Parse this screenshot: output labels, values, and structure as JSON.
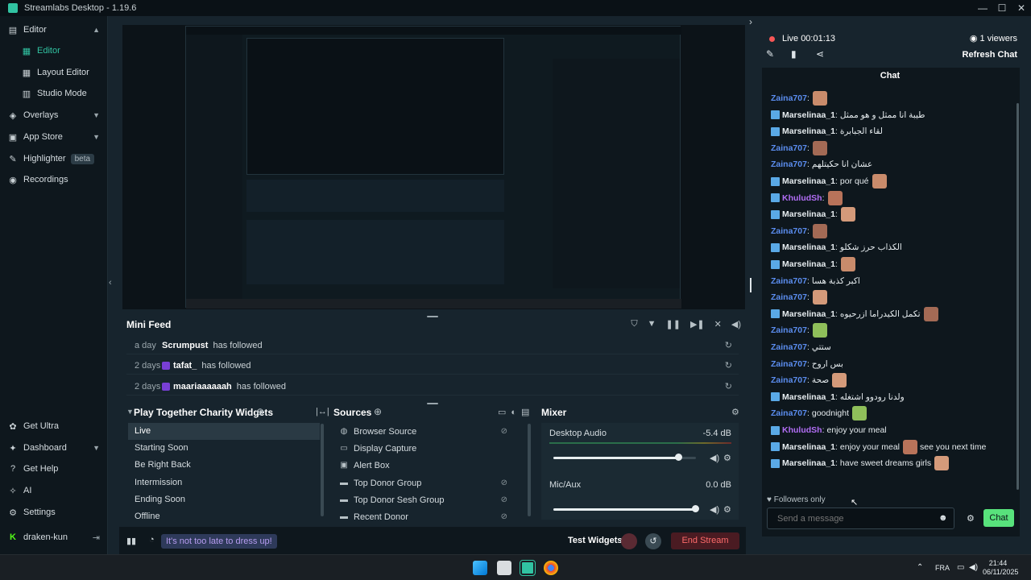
{
  "app": {
    "title": "Streamlabs Desktop - 1.19.6"
  },
  "window_controls": {
    "minimize": "—",
    "maximize": "☐",
    "close": "✕"
  },
  "sidebar": {
    "editor": "Editor",
    "editor_sub": "Editor",
    "layout_editor": "Layout Editor",
    "studio_mode": "Studio Mode",
    "overlays": "Overlays",
    "app_store": "App Store",
    "highlighter": "Highlighter",
    "highlighter_badge": "beta",
    "recordings": "Recordings",
    "get_ultra": "Get Ultra",
    "dashboard": "Dashboard",
    "get_help": "Get Help",
    "ai": "AI",
    "settings": "Settings",
    "user": "draken-kun"
  },
  "minifeed": {
    "title": "Mini Feed",
    "rows": [
      {
        "ago": "a day",
        "name": "Scrumpust",
        "action": "has followed"
      },
      {
        "ago": "2 days",
        "name": "tafat_",
        "action": "has followed"
      },
      {
        "ago": "2 days",
        "name": "maariaaaaaah",
        "action": "has followed"
      }
    ]
  },
  "scenes": {
    "title": "Play Together Charity Widgets",
    "items": [
      "Live",
      "Starting Soon",
      "Be Right Back",
      "Intermission",
      "Ending Soon",
      "Offline"
    ],
    "selected": "Live"
  },
  "sources": {
    "title": "Sources",
    "items": [
      {
        "label": "Browser Source",
        "icon": "globe-icon"
      },
      {
        "label": "Display Capture",
        "icon": "monitor-icon"
      },
      {
        "label": "Alert Box",
        "icon": "image-icon"
      },
      {
        "label": "Top Donor Group",
        "icon": "folder-icon"
      },
      {
        "label": "Top Donor Sesh Group",
        "icon": "folder-icon"
      },
      {
        "label": "Recent Donor",
        "icon": "folder-icon"
      }
    ]
  },
  "mixer": {
    "title": "Mixer",
    "channels": [
      {
        "name": "Desktop Audio",
        "value": "-5.4 dB",
        "level": 0.88
      },
      {
        "name": "Mic/Aux",
        "value": "0.0 dB",
        "level": 1.0
      }
    ]
  },
  "footer": {
    "notice": "It's not too late to dress up!",
    "test_widgets": "Test Widgets",
    "end_stream": "End Stream"
  },
  "stream": {
    "live_label": "Live",
    "live_time": "00:01:13",
    "viewers": "1 viewers",
    "refresh_chat": "Refresh Chat"
  },
  "chat": {
    "header": "Chat",
    "messages": [
      {
        "user": "Zaina707",
        "text": "",
        "emote": true,
        "badge": false,
        "color": "#5b8def"
      },
      {
        "user": "Marselinaa_1",
        "text": "طيبة انا ممثل و هو ممثل",
        "emote": false,
        "badge": true,
        "color": "#e6ecef"
      },
      {
        "user": "Marselinaa_1",
        "text": "لقاء الجبابرة",
        "emote": false,
        "badge": true,
        "color": "#e6ecef"
      },
      {
        "user": "Zaina707",
        "text": "",
        "emote": true,
        "badge": false,
        "color": "#5b8def"
      },
      {
        "user": "Zaina707",
        "text": "عشان انا حكيتلهم",
        "emote": false,
        "badge": false,
        "color": "#5b8def"
      },
      {
        "user": "Marselinaa_1",
        "text": "por qué",
        "emote": true,
        "badge": true,
        "color": "#e6ecef"
      },
      {
        "user": "KhuludSh",
        "text": "",
        "emote": true,
        "badge": true,
        "color": "#b26ef5"
      },
      {
        "user": "Marselinaa_1",
        "text": "",
        "emote": true,
        "badge": true,
        "color": "#e6ecef"
      },
      {
        "user": "Zaina707",
        "text": "",
        "emote": true,
        "badge": false,
        "color": "#5b8def"
      },
      {
        "user": "Marselinaa_1",
        "text": "الكذاب حرز شكلو",
        "emote": false,
        "badge": true,
        "color": "#e6ecef"
      },
      {
        "user": "Marselinaa_1",
        "text": "",
        "emote": true,
        "badge": true,
        "color": "#e6ecef"
      },
      {
        "user": "Zaina707",
        "text": "اكبر كذبة هسا",
        "emote": false,
        "badge": false,
        "color": "#5b8def"
      },
      {
        "user": "Zaina707",
        "text": "",
        "emote": true,
        "badge": false,
        "color": "#5b8def"
      },
      {
        "user": "Marselinaa_1",
        "text": "تكمل الكيدراما ازرحيوه",
        "emote": true,
        "badge": true,
        "color": "#e6ecef"
      },
      {
        "user": "Zaina707",
        "text": "",
        "emote": true,
        "badge": false,
        "color": "#5b8def"
      },
      {
        "user": "Zaina707",
        "text": "ستتي",
        "emote": false,
        "badge": false,
        "color": "#5b8def"
      },
      {
        "user": "Zaina707",
        "text": "بس اروح",
        "emote": false,
        "badge": false,
        "color": "#5b8def"
      },
      {
        "user": "Zaina707",
        "text": "صحة",
        "emote": true,
        "badge": false,
        "color": "#5b8def"
      },
      {
        "user": "Marselinaa_1",
        "text": "ولدنا رودوو اشتغله",
        "emote": false,
        "badge": true,
        "color": "#e6ecef"
      },
      {
        "user": "Zaina707",
        "text": "goodnight",
        "emote": true,
        "badge": false,
        "color": "#5b8def"
      },
      {
        "user": "KhuludSh",
        "text": "enjoy your meal",
        "emote": false,
        "badge": true,
        "color": "#b26ef5"
      },
      {
        "user": "Marselinaa_1",
        "text": "enjoy your meal",
        "emote": true,
        "badge": true,
        "color": "#e6ecef",
        "suffix": "see you next time"
      },
      {
        "user": "Marselinaa_1",
        "text": "have sweet dreams girls",
        "emote": true,
        "badge": true,
        "color": "#e6ecef"
      }
    ],
    "followers_only": "Followers only",
    "input_placeholder": "Send a message",
    "send_label": "Chat"
  },
  "taskbar": {
    "lang": "FRA",
    "time": "21:44",
    "date": "06/11/2025"
  },
  "colors": {
    "accent": "#31c3a2",
    "send": "#58e27c",
    "live": "#f85656"
  }
}
